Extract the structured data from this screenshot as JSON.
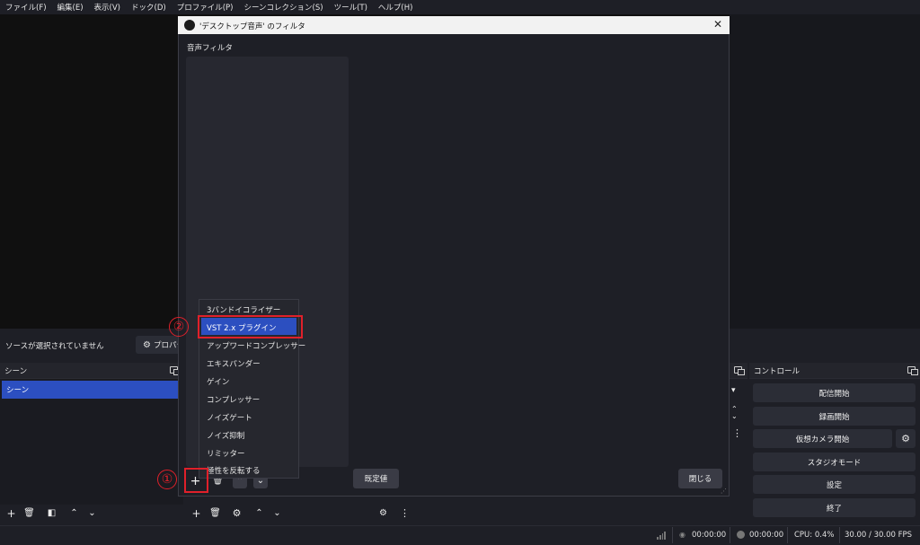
{
  "menu": [
    "ファイル(F)",
    "編集(E)",
    "表示(V)",
    "ドック(D)",
    "プロファイル(P)",
    "シーンコレクション(S)",
    "ツール(T)",
    "ヘルプ(H)"
  ],
  "sourcebar": {
    "no_source": "ソースが選択されていません",
    "properties": "プロパティ"
  },
  "scenes": {
    "title": "シーン",
    "item": "シーン"
  },
  "controls": {
    "title": "コントロール",
    "start_stream": "配信開始",
    "start_record": "録画開始",
    "start_vcam": "仮想カメラ開始",
    "studio_mode": "スタジオモード",
    "settings": "設定",
    "exit": "終了"
  },
  "status": {
    "stream_time": "00:00:00",
    "record_time": "00:00:00",
    "cpu": "CPU: 0.4%",
    "fps": "30.00 / 30.00 FPS"
  },
  "dialog": {
    "title": "'デスクトップ音声' のフィルタ",
    "audio_filters_label": "音声フィルタ",
    "defaults": "既定値",
    "close": "閉じる"
  },
  "filter_menu": [
    "3バンドイコライザー",
    "VST 2.x プラグイン",
    "アップワードコンプレッサー",
    "エキスパンダー",
    "ゲイン",
    "コンプレッサー",
    "ノイズゲート",
    "ノイズ抑制",
    "リミッター",
    "極性を反転する"
  ],
  "annotations": {
    "step1": "①",
    "step2": "②"
  },
  "colors": {
    "accent": "#2c4fc0",
    "annotation": "#e0202a",
    "background": "#1e1f26"
  }
}
